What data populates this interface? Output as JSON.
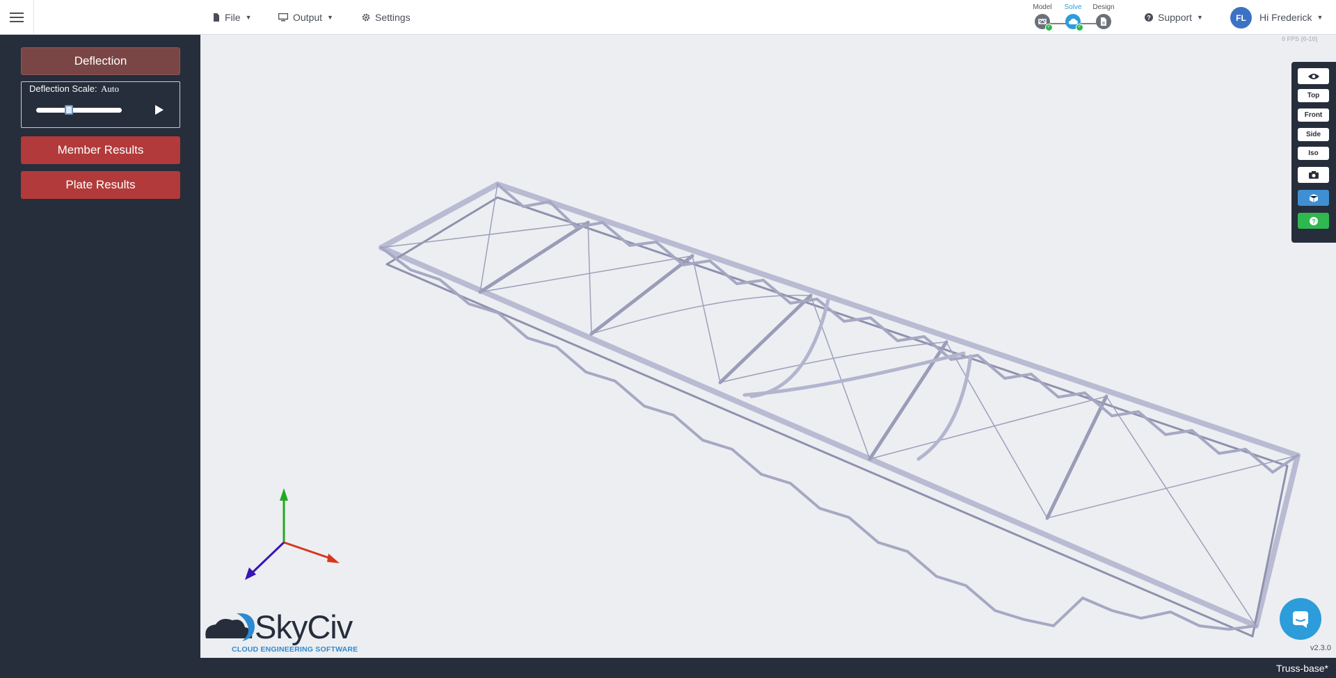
{
  "topbar": {
    "menu_icon": "hamburger-icon",
    "file": {
      "label": "File",
      "icon": "file-icon"
    },
    "output": {
      "label": "Output",
      "icon": "monitor-icon"
    },
    "settings": {
      "label": "Settings",
      "icon": "gear-icon"
    },
    "steps": [
      {
        "label": "Model",
        "active": false,
        "done": true
      },
      {
        "label": "Solve",
        "active": true,
        "done": true
      },
      {
        "label": "Design",
        "active": false,
        "done": false
      }
    ],
    "support": {
      "label": "Support",
      "icon": "question-circle-icon"
    },
    "user": {
      "initials": "FL",
      "greeting": "Hi Frederick"
    }
  },
  "sidebar": {
    "deflection_label": "Deflection",
    "scale_label": "Deflection Scale:",
    "scale_value": "Auto",
    "scale_slider_fraction": 0.38,
    "member_results_label": "Member Results",
    "plate_results_label": "Plate Results"
  },
  "viewport": {
    "fps": "0 FPS (0-10)",
    "toolbar": [
      "eye-icon",
      "Top",
      "Front",
      "Side",
      "Iso",
      "camera-icon",
      "cube-icon",
      "help-icon"
    ]
  },
  "logo": {
    "name": "SkyCiv",
    "tagline": "CLOUD ENGINEERING SOFTWARE"
  },
  "version": "v2.3.0",
  "file_name": "Truss-base*",
  "colors": {
    "sidebar_bg": "#262d3b",
    "button_red": "#b23a3a",
    "button_active": "#7a4645",
    "accent_blue": "#2d9cdb",
    "canvas_bg": "#eceef2",
    "truss_member": "#b9bbd3"
  }
}
